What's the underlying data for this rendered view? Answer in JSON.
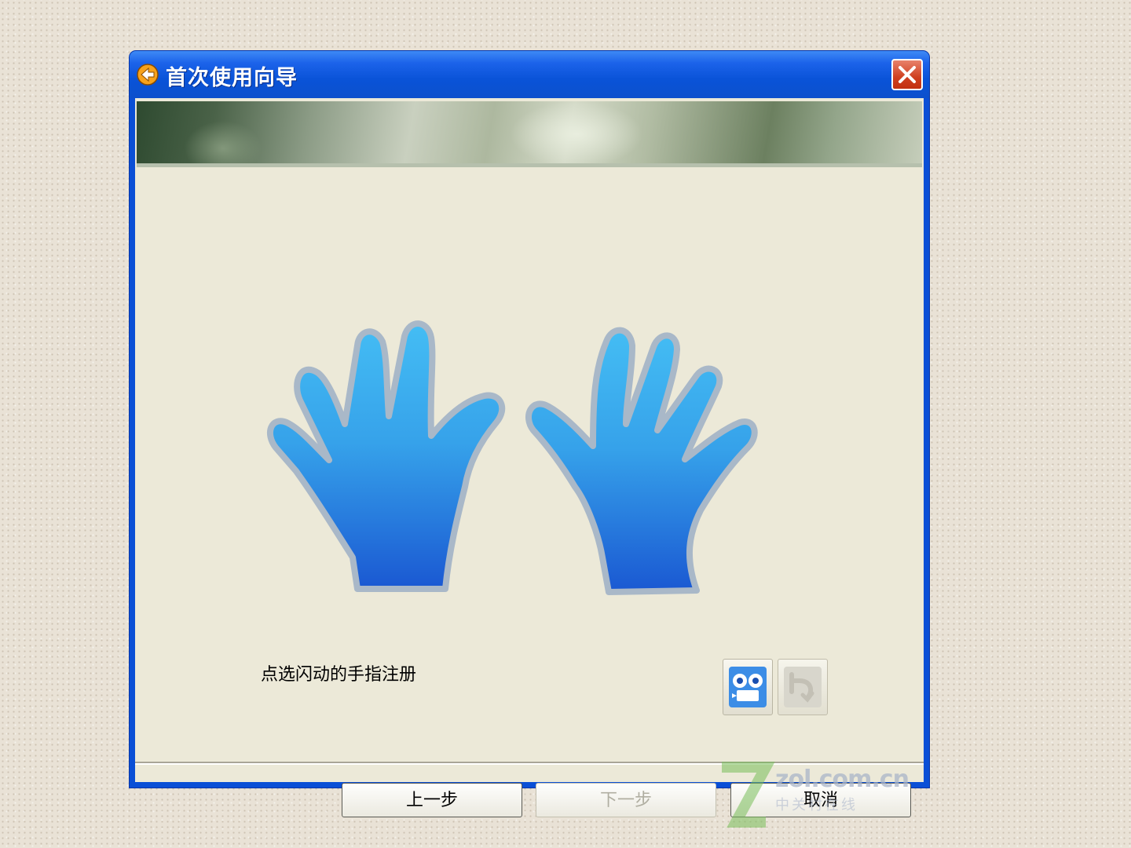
{
  "window": {
    "title": "首次使用向导",
    "close_icon": "close-icon"
  },
  "content": {
    "instruction": "点选闪动的手指注册",
    "tools": [
      {
        "name": "webcam-icon"
      },
      {
        "name": "undo-icon"
      }
    ]
  },
  "footer": {
    "back_label": "上一步",
    "next_label": "下一步",
    "cancel_label": "取消"
  },
  "watermark": {
    "text": "zol.com.cn",
    "subtext": "中关村在线"
  },
  "colors": {
    "titlebar": "#0a53d8",
    "client": "#ece9d8",
    "hand_light": "#3fb4f0",
    "hand_dark": "#1f62d6"
  }
}
